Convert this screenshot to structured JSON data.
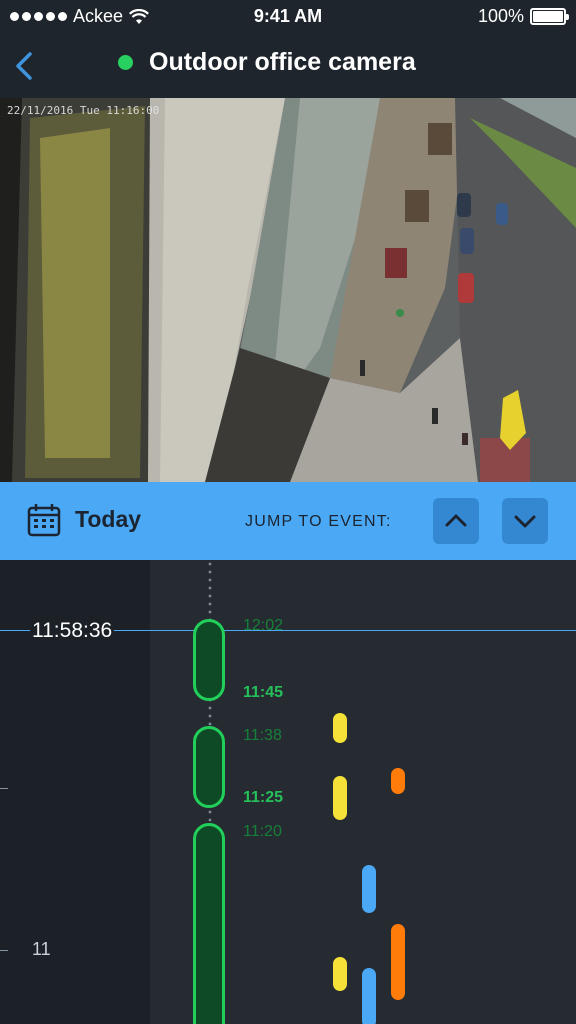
{
  "status_bar": {
    "carrier": "Ackee",
    "time": "9:41 AM",
    "battery": "100%",
    "battery_level": 1.0
  },
  "header": {
    "title": "Outdoor office camera",
    "status": "online",
    "status_color": "#28d061"
  },
  "camera": {
    "timestamp": "22/11/2016 Tue 11:16:00"
  },
  "toolbar": {
    "date_label": "Today",
    "jump_label": "JUMP TO EVENT:",
    "up_icon": "chevron-up-icon",
    "down_icon": "chevron-down-icon",
    "accent_color": "#4aa8f5"
  },
  "timeline": {
    "current_time": "11:58:36",
    "hour_label": "11",
    "recordings": [
      {
        "start_label": "12:02",
        "end_label": "11:45"
      },
      {
        "start_label": "11:38",
        "end_label": "11:25"
      },
      {
        "start_label": "11:20",
        "end_label": ""
      }
    ],
    "event_colors": {
      "yellow": "#f6e138",
      "orange": "#ff7b0a",
      "blue": "#4aa8f5"
    }
  }
}
